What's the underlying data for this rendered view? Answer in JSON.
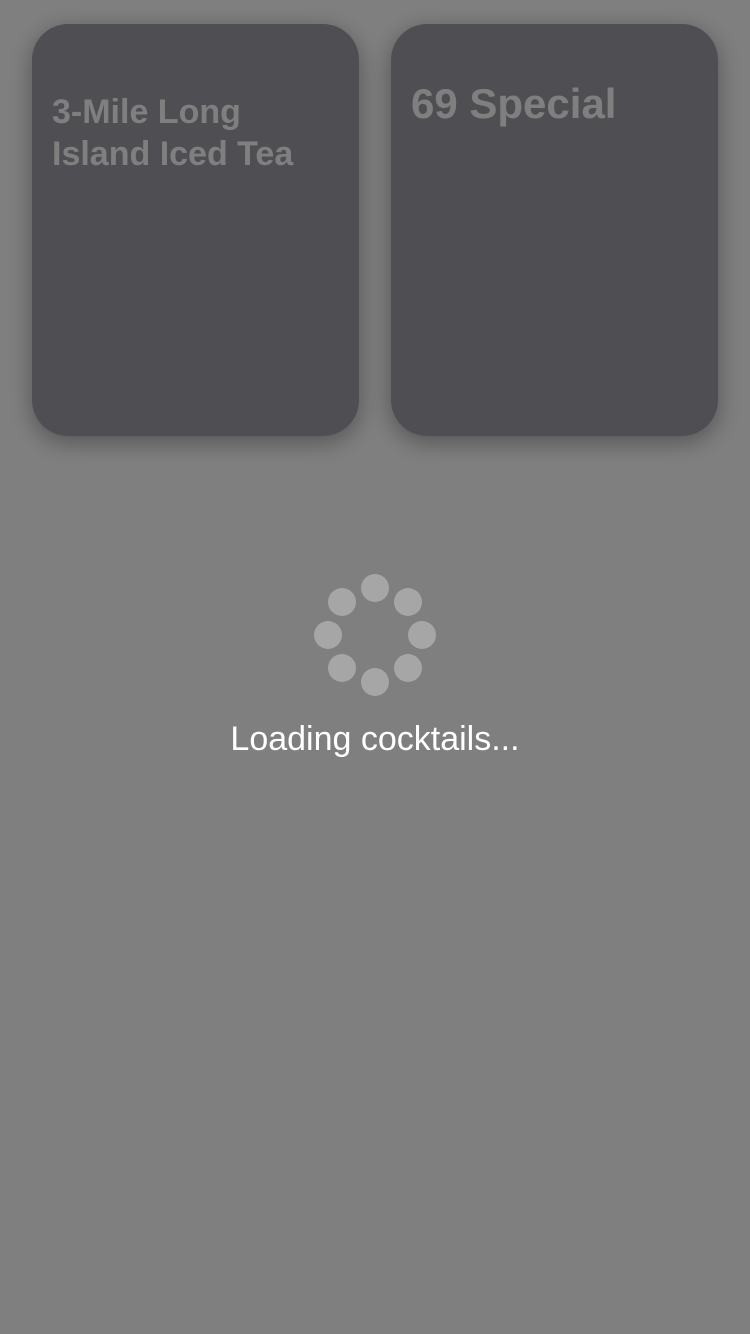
{
  "cards": [
    {
      "title": "3-Mile Long Island Iced Tea"
    },
    {
      "title": "69 Special"
    }
  ],
  "loading": {
    "message": "Loading cocktails...",
    "icon": "spinner-icon"
  },
  "colors": {
    "card_background": "#9f9ea7",
    "overlay": "rgba(0,0,0,0.5)",
    "text": "#ffffff",
    "spinner_dot": "#a6a6a6"
  }
}
